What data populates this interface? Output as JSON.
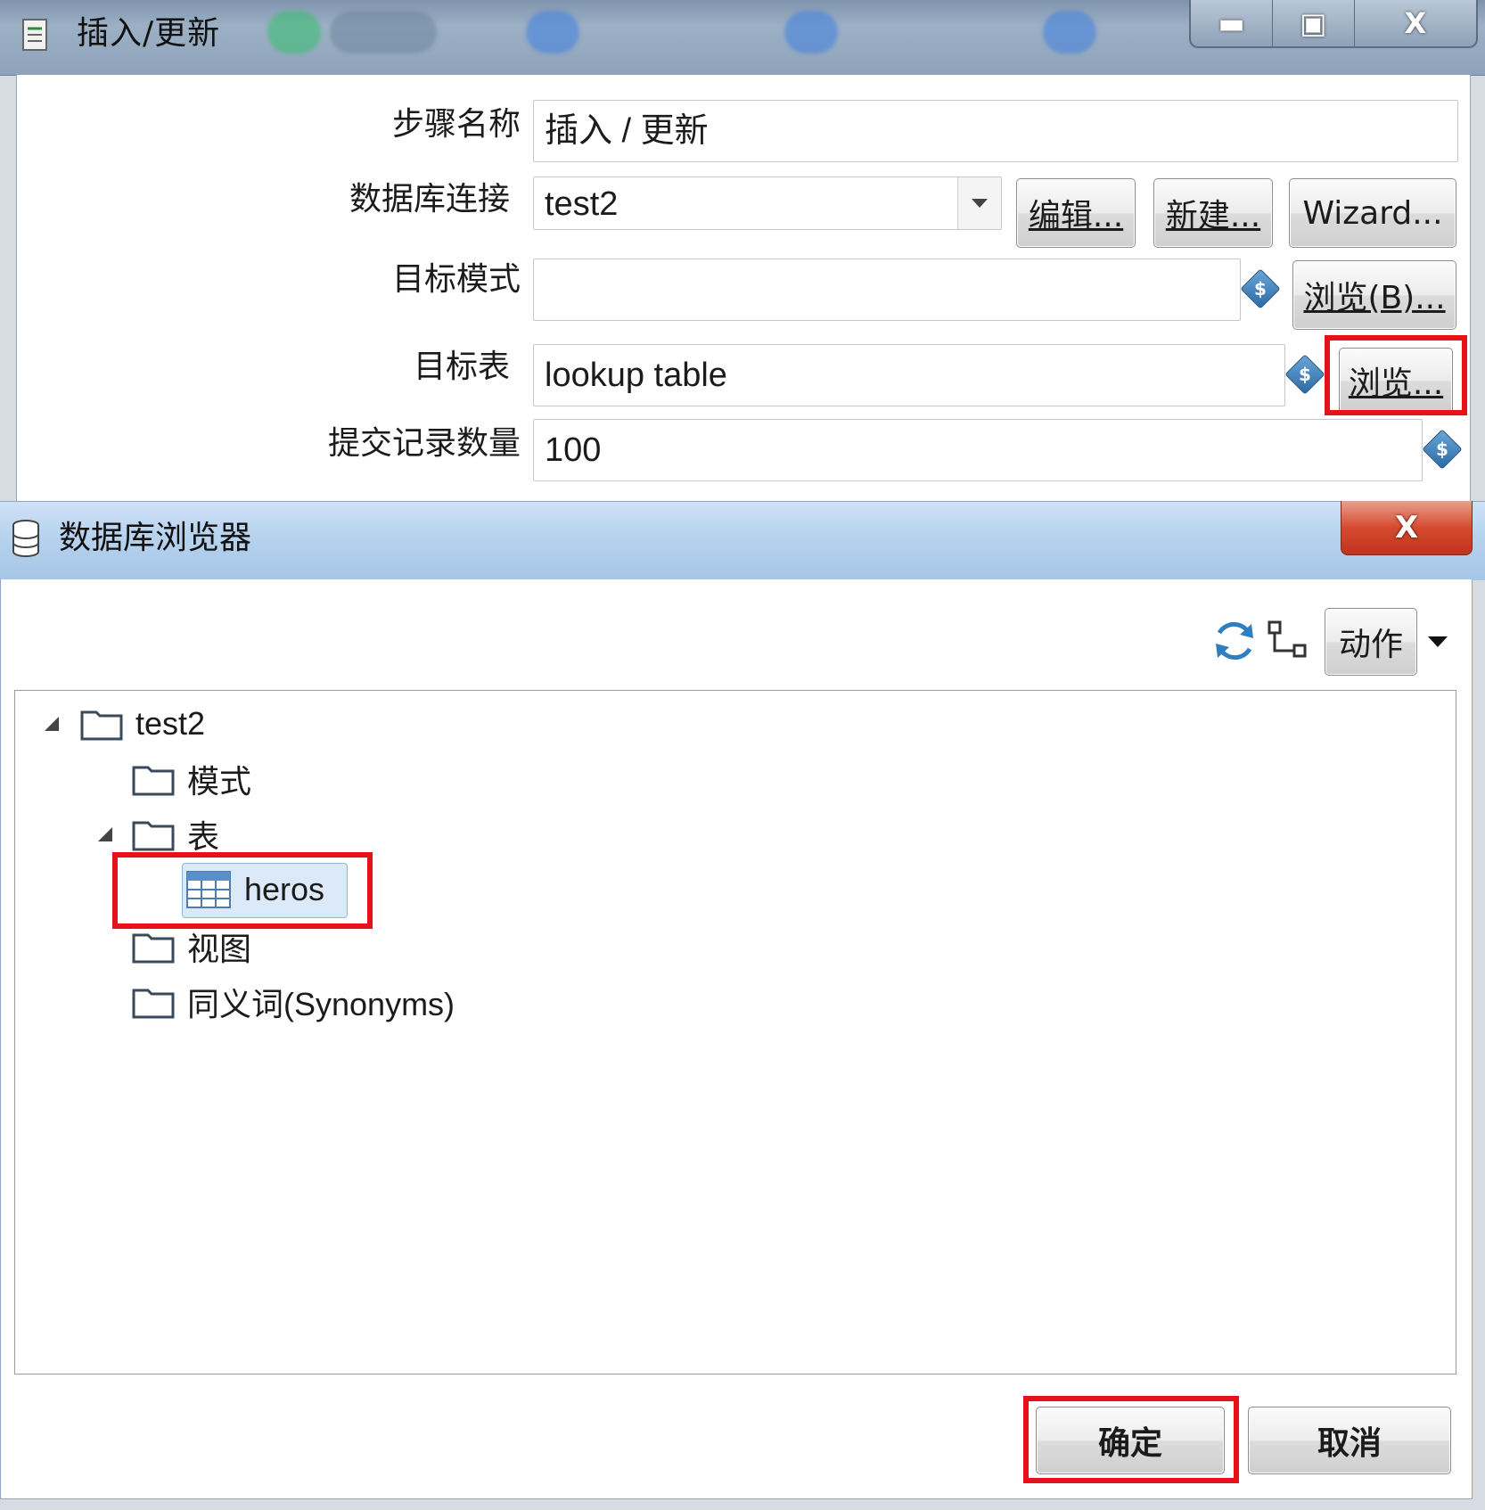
{
  "window": {
    "title": "插入/更新",
    "controls": {
      "minimize": "▬",
      "maximize": "▣",
      "close": "X"
    }
  },
  "form": {
    "step_name": {
      "label": "步骤名称",
      "value": "插入 / 更新"
    },
    "db_connection": {
      "label": "数据库连接",
      "value": "test2",
      "edit_button": "编辑...",
      "new_button": "新建...",
      "wizard_button": "Wizard..."
    },
    "target_schema": {
      "label": "目标模式",
      "value": "",
      "browse_button": "浏览(B)..."
    },
    "target_table": {
      "label": "目标表",
      "value": "lookup table",
      "browse_button": "浏览..."
    },
    "commit_size": {
      "label": "提交记录数量",
      "value": "100"
    },
    "variable_icon": "$"
  },
  "db_browser": {
    "title": "数据库浏览器",
    "close": "X",
    "toolbar": {
      "action_button": "动作"
    },
    "tree": {
      "root": "test2",
      "schemas": "模式",
      "tables": "表",
      "table_item": "heros",
      "views": "视图",
      "synonyms": "同义词(Synonyms)"
    },
    "ok_button": "确定",
    "cancel_button": "取消"
  },
  "colors": {
    "highlight_red": "#e8101a",
    "selection_blue": "#dbe9f8"
  }
}
